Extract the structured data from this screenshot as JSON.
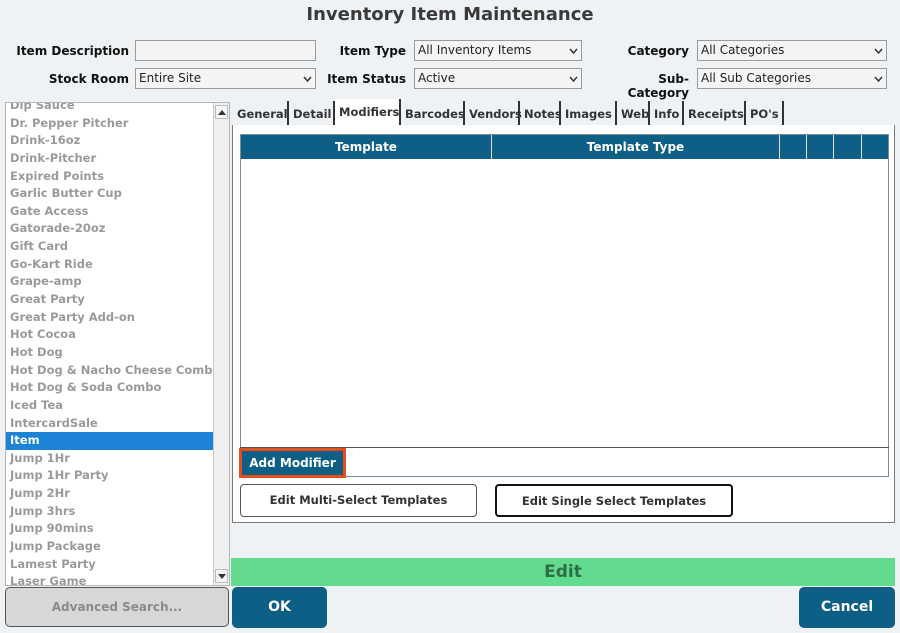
{
  "window": {
    "title": "Inventory Item Maintenance"
  },
  "filters": {
    "item_description_label": "Item Description",
    "item_description_value": "",
    "stock_room_label": "Stock Room",
    "stock_room_value": "Entire Site",
    "item_type_label": "Item Type",
    "item_type_value": "All Inventory Items",
    "item_status_label": "Item Status",
    "item_status_value": "Active",
    "category_label": "Category",
    "category_value": "All Categories",
    "sub_category_label": "Sub-Category",
    "sub_category_value": "All Sub Categories"
  },
  "item_list": {
    "items": [
      "Dip Sauce",
      "Dr. Pepper Pitcher",
      "Drink-16oz",
      "Drink-Pitcher",
      "Expired Points",
      "Garlic Butter Cup",
      "Gate Access",
      "Gatorade-20oz",
      "Gift Card",
      "Go-Kart Ride",
      "Grape-amp",
      "Great Party",
      "Great Party Add-on",
      "Hot Cocoa",
      "Hot Dog",
      "Hot Dog & Nacho Cheese Combo",
      "Hot Dog & Soda Combo",
      "Iced Tea",
      "IntercardSale",
      "Item",
      "Jump 1Hr",
      "Jump 1Hr Party",
      "Jump 2Hr",
      "Jump 3hrs",
      "Jump 90mins",
      "Jump Package",
      "Lamest Party",
      "Laser Game"
    ],
    "selected": "Item"
  },
  "tabs": [
    {
      "label": "General"
    },
    {
      "label": "Detail"
    },
    {
      "label": "Modifiers"
    },
    {
      "label": "Barcodes"
    },
    {
      "label": "Vendors"
    },
    {
      "label": "Notes"
    },
    {
      "label": "Images"
    },
    {
      "label": "Web"
    },
    {
      "label": "Info"
    },
    {
      "label": "Receipts"
    },
    {
      "label": "PO's"
    }
  ],
  "active_tab": "Modifiers",
  "modifiers": {
    "columns": {
      "template": "Template",
      "template_type": "Template Type"
    },
    "add_modifier_label": "Add Modifier",
    "edit_multi_label": "Edit Multi-Select Templates",
    "edit_single_label": "Edit Single Select Templates"
  },
  "mode": {
    "label": "Edit"
  },
  "footer": {
    "advanced_search_label": "Advanced Search...",
    "ok_label": "OK",
    "cancel_label": "Cancel"
  },
  "colors": {
    "header_blue": "#0d5f86",
    "selection_blue": "#1c83d6",
    "edit_green": "#63db8e",
    "highlight_orange": "#e84e1b"
  },
  "icons": {
    "dropdown": "chevron-down-icon",
    "scroll_up": "scroll-up-icon",
    "scroll_down": "scroll-down-icon"
  }
}
